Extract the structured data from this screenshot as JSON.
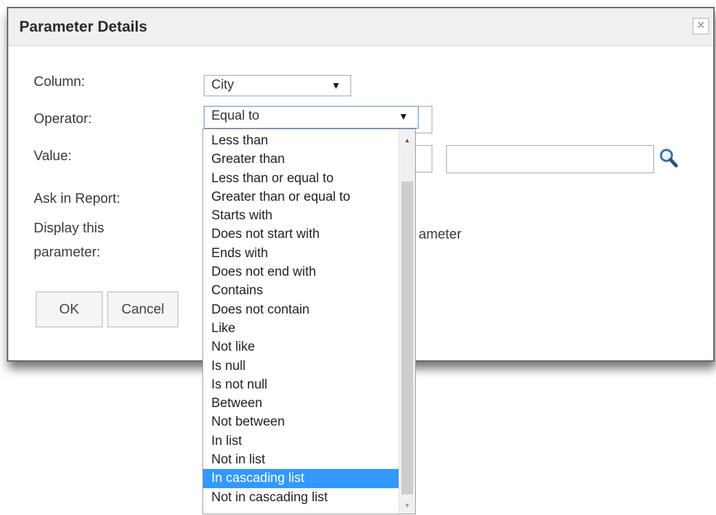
{
  "dialog": {
    "title": "Parameter Details",
    "close_symbol": "×"
  },
  "labels": {
    "column": "Column:",
    "operator": "Operator:",
    "value": "Value:",
    "ask_in_report": "Ask in Report:",
    "display_line1": "Display this",
    "display_line2": "parameter:"
  },
  "column_select": {
    "value": "City",
    "arrow": "▼"
  },
  "operator_select": {
    "value": "Equal to",
    "arrow": "▼"
  },
  "partial_text": "ameter",
  "buttons": {
    "ok": "OK",
    "cancel": "Cancel"
  },
  "dropdown": {
    "options": [
      "Less than",
      "Greater than",
      "Less than or equal to",
      "Greater than or equal to",
      "Starts with",
      "Does not start with",
      "Ends with",
      "Does not end with",
      "Contains",
      "Does not contain",
      "Like",
      "Not like",
      "Is null",
      "Is not null",
      "Between",
      "Not between",
      "In list",
      "Not in list",
      "In cascading list",
      "Not in cascading list"
    ],
    "selected_index": 18,
    "scroll_up": "▲",
    "scroll_down": "▼"
  },
  "icons": {
    "search": "magnifier-icon"
  },
  "colors": {
    "selection": "#3399ff",
    "focus_border": "#5a8ec9"
  }
}
